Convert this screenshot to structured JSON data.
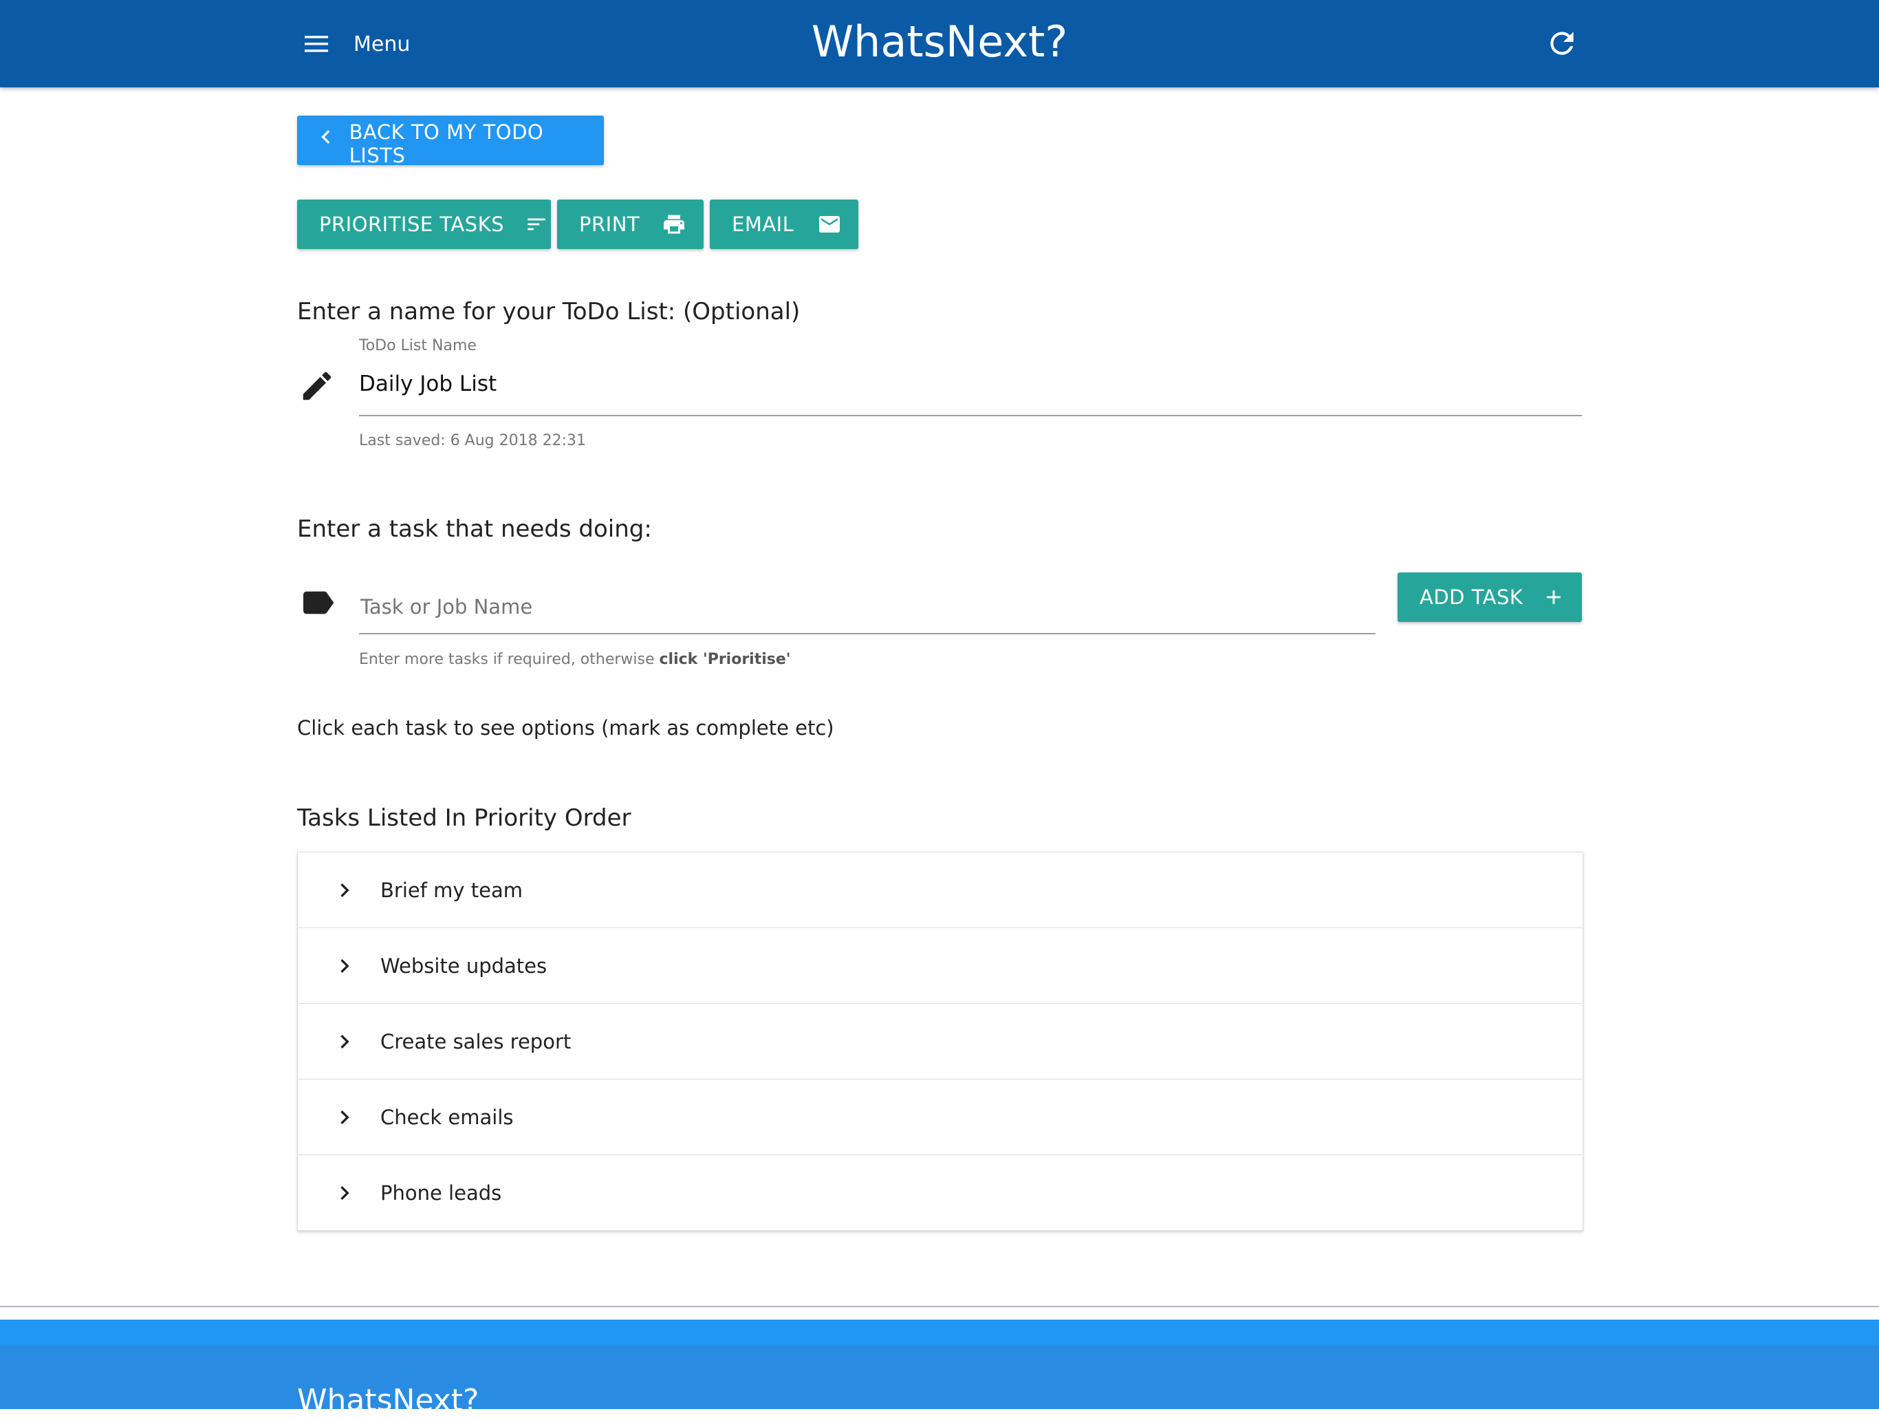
{
  "header": {
    "menu_label": "Menu",
    "title": "WhatsNext?",
    "icons": {
      "menu": "hamburger-icon",
      "refresh": "refresh-icon"
    }
  },
  "nav": {
    "back_label": "BACK TO MY TODO LISTS"
  },
  "actions": {
    "prioritise_label": "PRIORITISE TASKS",
    "print_label": "PRINT",
    "email_label": "EMAIL"
  },
  "list_name": {
    "heading": "Enter a name for your ToDo List: (Optional)",
    "field_label": "ToDo List Name",
    "value": "Daily Job List",
    "last_saved": "Last saved: 6 Aug 2018 22:31"
  },
  "task_entry": {
    "heading": "Enter a task that needs doing:",
    "placeholder": "Task or Job Name",
    "add_label": "ADD TASK",
    "hint_prefix": "Enter more tasks if required, otherwise ",
    "hint_bold": "click 'Prioritise'",
    "instructions": "Click each task to see options (mark as complete etc)"
  },
  "tasks": {
    "heading": "Tasks Listed In Priority Order",
    "items": [
      {
        "label": "Brief my team"
      },
      {
        "label": "Website updates"
      },
      {
        "label": "Create sales report"
      },
      {
        "label": "Check emails"
      },
      {
        "label": "Phone leads"
      }
    ]
  },
  "footer": {
    "title": "WhatsNext?"
  },
  "colors": {
    "header_bg": "#0a5aa6",
    "primary_blue": "#2196f3",
    "teal": "#26a69a"
  }
}
